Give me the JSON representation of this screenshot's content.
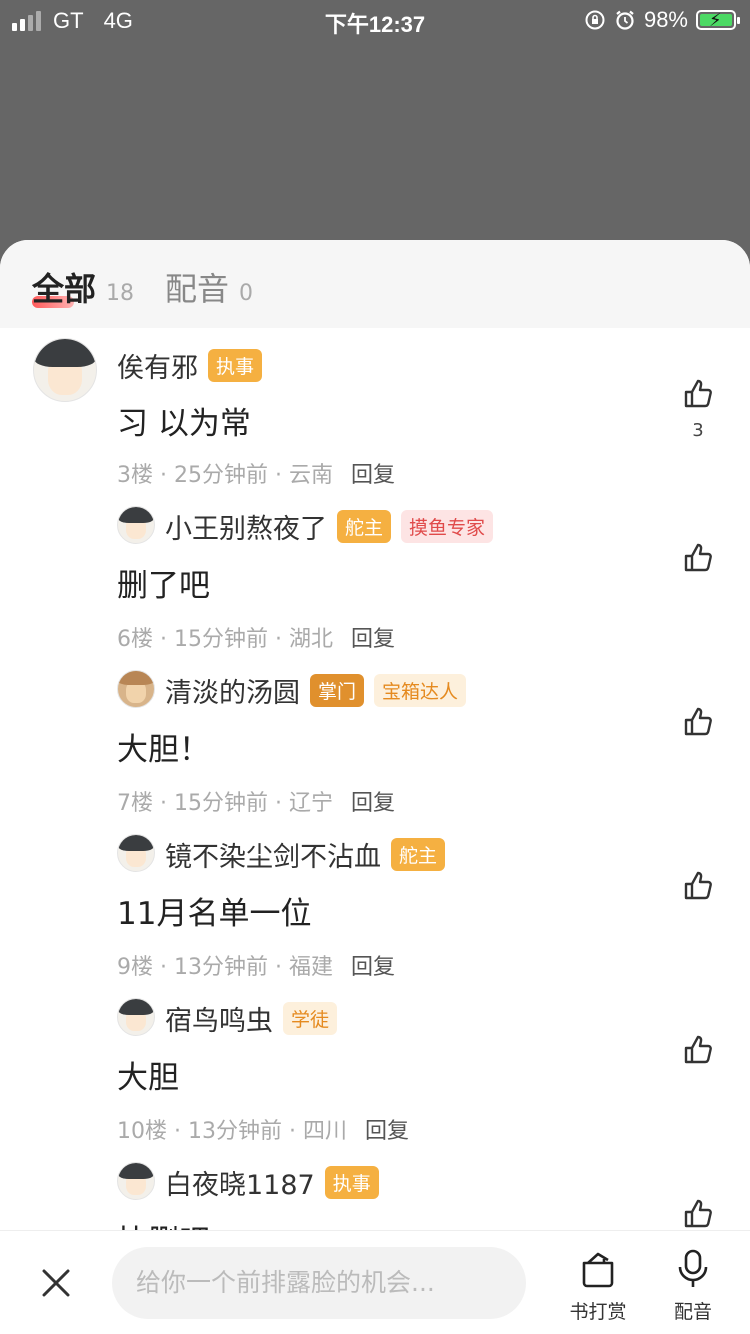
{
  "status_bar": {
    "carrier": "GT",
    "network": "4G",
    "time": "下午12:37",
    "battery": "98%",
    "battery_level": 0.98
  },
  "tabs": [
    {
      "label": "全部",
      "count": "18"
    },
    {
      "label": "配音",
      "count": "0"
    }
  ],
  "comments": [
    {
      "user": "俟有邪",
      "badges": [
        "执事"
      ],
      "text": "习 以为常",
      "floor": "3楼",
      "time": "25分钟前",
      "region": "云南",
      "reply": "回复",
      "likes": "3"
    },
    {
      "user": "小王别熬夜了",
      "badges": [
        "舵主",
        "摸鱼专家"
      ],
      "text": "删了吧",
      "floor": "6楼",
      "time": "15分钟前",
      "region": "湖北",
      "reply": "回复"
    },
    {
      "user": "清淡的汤圆",
      "badges": [
        "掌门",
        "宝箱达人"
      ],
      "text": "大胆！",
      "floor": "7楼",
      "time": "15分钟前",
      "region": "辽宁",
      "reply": "回复"
    },
    {
      "user": "镜不染尘剑不沾血",
      "badges": [
        "舵主"
      ],
      "text": "11月名单一位",
      "floor": "9楼",
      "time": "13分钟前",
      "region": "福建",
      "reply": "回复"
    },
    {
      "user": "宿鸟鸣虫",
      "badges": [
        "学徒"
      ],
      "text": "大胆",
      "floor": "10楼",
      "time": "13分钟前",
      "region": "四川",
      "reply": "回复"
    },
    {
      "user": "白夜晓1187",
      "badges": [
        "执事"
      ],
      "text": "快删吧",
      "floor": "",
      "time": "",
      "region": "",
      "reply": ""
    }
  ],
  "bottom_bar": {
    "placeholder": "给你一个前排露脸的机会...",
    "reward_label": "书打赏",
    "dub_label": "配音"
  },
  "colors": {
    "overlay": "#666666",
    "badge_orange": "#f5b041",
    "badge_dark_orange": "#e0902d",
    "badge_pink_text": "#e04a4a",
    "tab_accent": "#ff5a5a"
  }
}
